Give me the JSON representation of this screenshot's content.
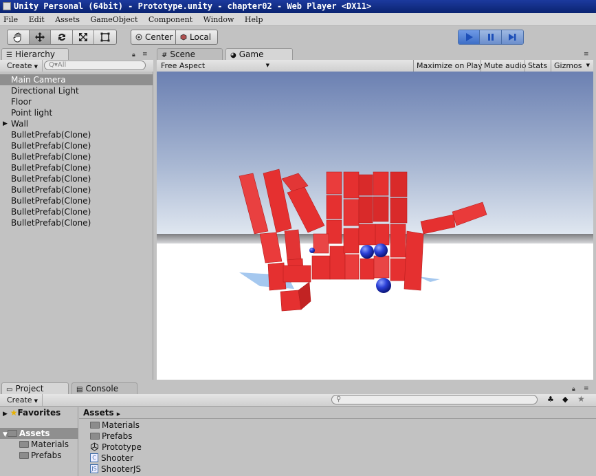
{
  "window": {
    "title": "Unity Personal (64bit) - Prototype.unity - chapter02 - Web Player <DX11>"
  },
  "menu": {
    "items": [
      "File",
      "Edit",
      "Assets",
      "GameObject",
      "Component",
      "Window",
      "Help"
    ]
  },
  "toolbar": {
    "center_label": "Center",
    "local_label": "Local"
  },
  "hierarchy": {
    "tab_label": "Hierarchy",
    "create_label": "Create",
    "search_placeholder": "Q▾All",
    "items": [
      "Main Camera",
      "Directional Light",
      "Floor",
      "Point light",
      "Wall",
      "BulletPrefab(Clone)",
      "BulletPrefab(Clone)",
      "BulletPrefab(Clone)",
      "BulletPrefab(Clone)",
      "BulletPrefab(Clone)",
      "BulletPrefab(Clone)",
      "BulletPrefab(Clone)",
      "BulletPrefab(Clone)",
      "BulletPrefab(Clone)"
    ]
  },
  "views": {
    "scene_tab": "Scene",
    "game_tab": "Game"
  },
  "game": {
    "aspect": "Free Aspect",
    "maximize": "Maximize on Play",
    "mute": "Mute audio",
    "stats": "Stats",
    "gizmos": "Gizmos"
  },
  "project": {
    "project_tab": "Project",
    "console_tab": "Console",
    "create_label": "Create",
    "favorites_label": "Favorites",
    "assets_label": "Assets",
    "tree_children": [
      "Materials",
      "Prefabs"
    ],
    "breadcrumb": "Assets",
    "assets": [
      {
        "name": "Materials",
        "icon": "folder-icon"
      },
      {
        "name": "Prefabs",
        "icon": "folder-icon"
      },
      {
        "name": "Prototype",
        "icon": "unity-scene-icon"
      },
      {
        "name": "Shooter",
        "icon": "csharp-script-icon"
      },
      {
        "name": "ShooterJS",
        "icon": "js-script-icon"
      }
    ]
  },
  "colors": {
    "play_active": "#4a7cd1",
    "selection": "#8f8f8f",
    "cube": "#e53030",
    "sphere": "#2a3fd6"
  }
}
